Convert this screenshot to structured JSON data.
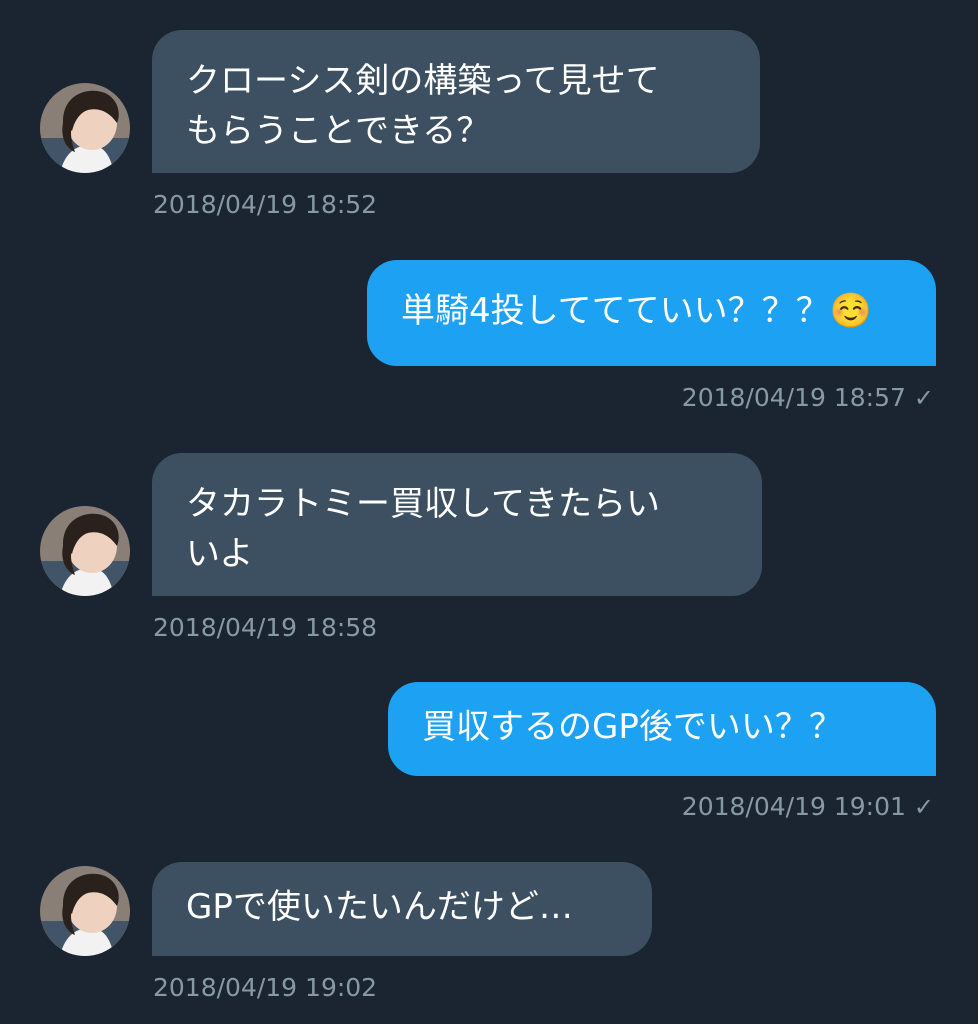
{
  "messages": [
    {
      "sender": "other",
      "text": "クローシス剣の構築って見せて\nもらうことできる？",
      "timestamp": "2018/04/19 18:52"
    },
    {
      "sender": "me",
      "text": "単騎4投しててていい？？？☺️",
      "timestamp": "2018/04/19 18:57",
      "status_icon": "check-icon"
    },
    {
      "sender": "other",
      "text": "タカラトミー買収してきたらい\nいよ",
      "timestamp": "2018/04/19 18:58"
    },
    {
      "sender": "me",
      "text": "買収するのGP後でいい？？",
      "timestamp": "2018/04/19 19:01",
      "status_icon": "check-icon"
    },
    {
      "sender": "other",
      "text": "GPで使いたいんだけど…",
      "timestamp": "2018/04/19 19:02"
    }
  ],
  "colors": {
    "background": "#1b2532",
    "incoming_bubble": "#3d5061",
    "outgoing_bubble": "#1da1f2",
    "timestamp": "#8899a6"
  }
}
